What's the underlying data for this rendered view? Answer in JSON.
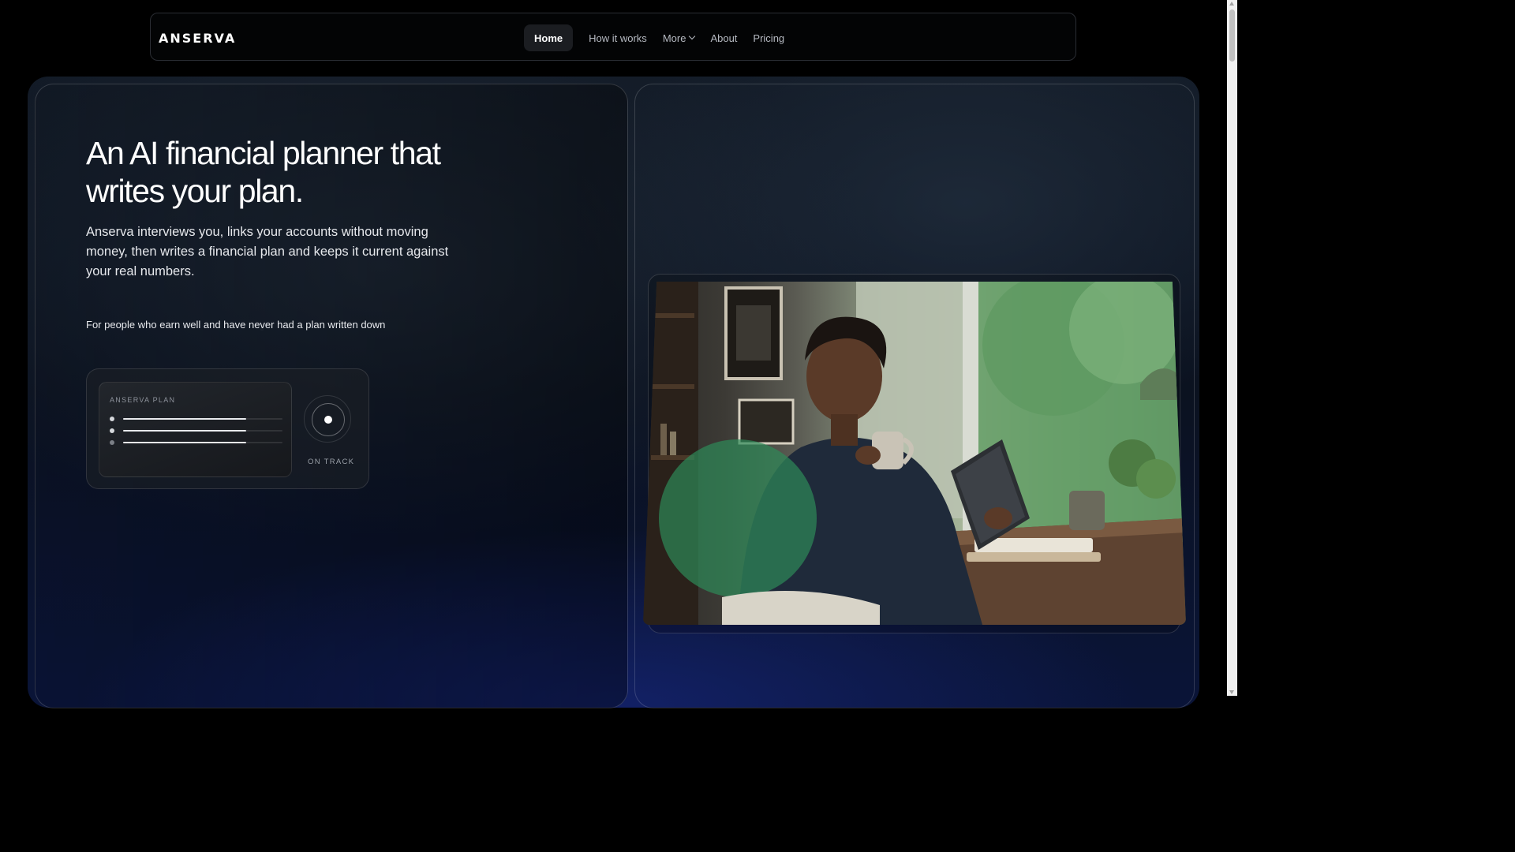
{
  "brand": {
    "logo_text": "ANSERVA"
  },
  "nav": {
    "items": [
      {
        "label": "Home",
        "active": true
      },
      {
        "label": "How it works"
      },
      {
        "label": "More",
        "has_dropdown": true
      },
      {
        "label": "About"
      },
      {
        "label": "Pricing"
      }
    ]
  },
  "hero": {
    "heading": "An AI financial planner that writes your plan.",
    "lead": "Anserva interviews you, links your accounts without moving money, then writes a financial plan and keeps it current against your real numbers.",
    "audience": "For people who earn well and have never had a plan written down"
  },
  "plan_card": {
    "label": "ANSERVA PLAN",
    "lines": [
      {
        "progress": 0.77
      },
      {
        "progress": 0.77
      },
      {
        "progress": 0.77
      }
    ],
    "status": "ON TRACK"
  },
  "photo": {
    "icon": "photo-woman-tablet-icon"
  },
  "colors": {
    "accent": "#2e8a5a",
    "hero_bottom": "#0a1438"
  }
}
